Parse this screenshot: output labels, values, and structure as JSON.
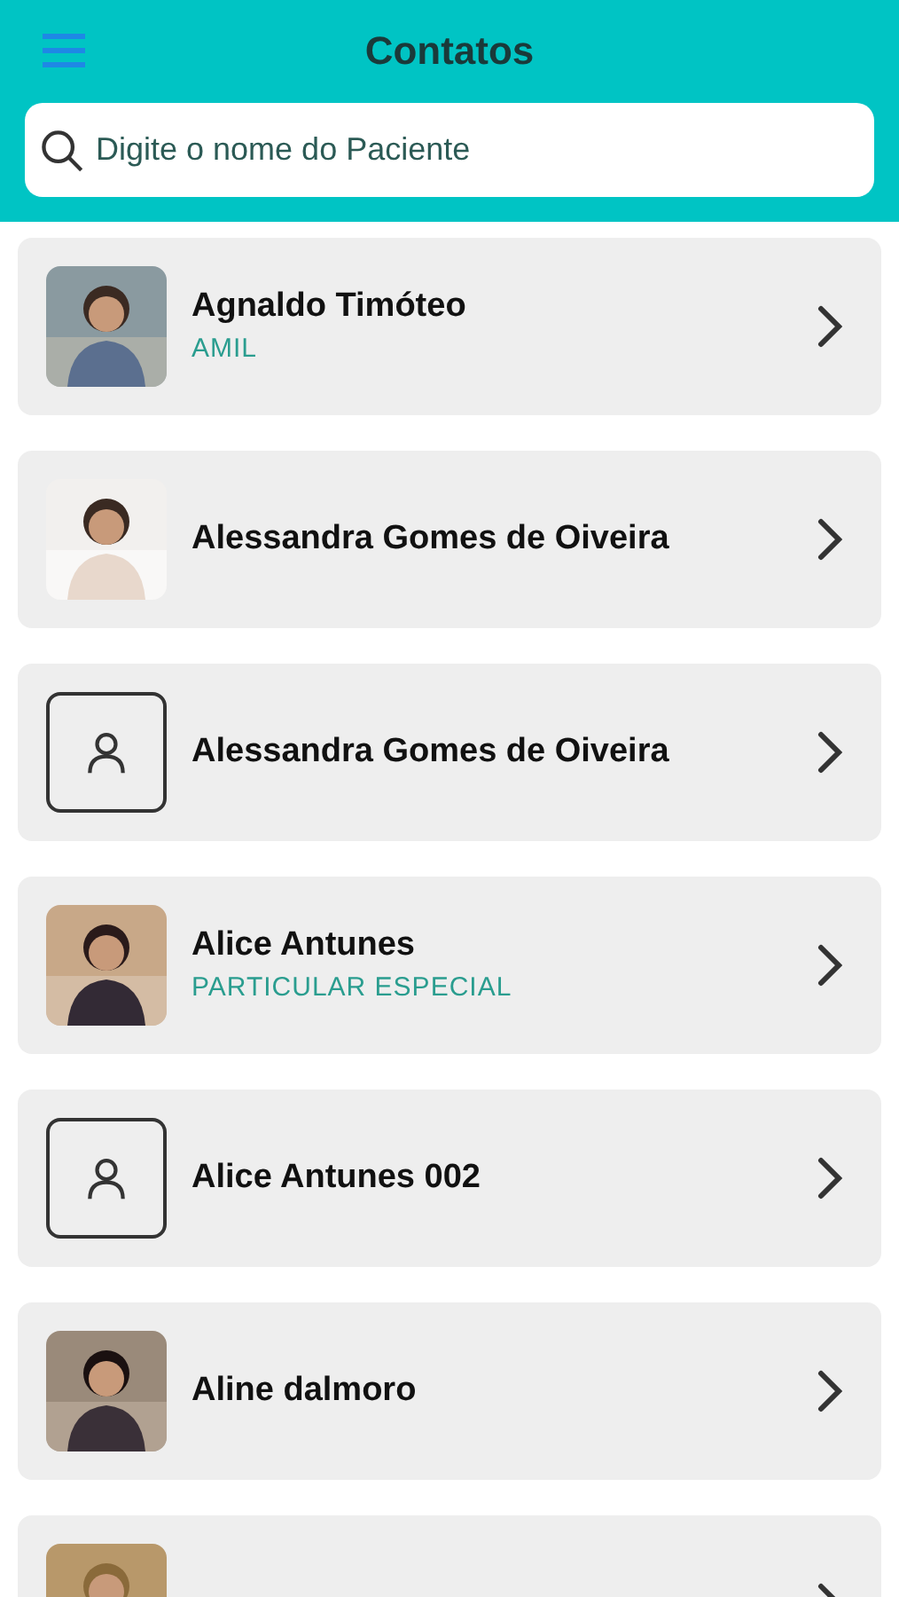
{
  "header": {
    "title": "Contatos"
  },
  "search": {
    "placeholder": "Digite o nome do Paciente"
  },
  "contacts": [
    {
      "name": "Agnaldo Timóteo",
      "plan": "AMIL",
      "avatar": {
        "kind": "picture"
      }
    },
    {
      "name": "Alessandra Gomes de Oiveira",
      "avatar": {
        "kind": "picture"
      }
    },
    {
      "name": "Alessandra Gomes de Oiveira",
      "avatar": {
        "kind": "placeholder"
      }
    },
    {
      "name": "Alice Antunes",
      "plan": "PARTICULAR ESPECIAL",
      "avatar": {
        "kind": "picture"
      }
    },
    {
      "name": "Alice Antunes 002",
      "avatar": {
        "kind": "placeholder"
      }
    },
    {
      "name": "Aline dalmoro",
      "avatar": {
        "kind": "picture"
      }
    },
    {
      "avatar": {
        "kind": "picture"
      }
    }
  ]
}
